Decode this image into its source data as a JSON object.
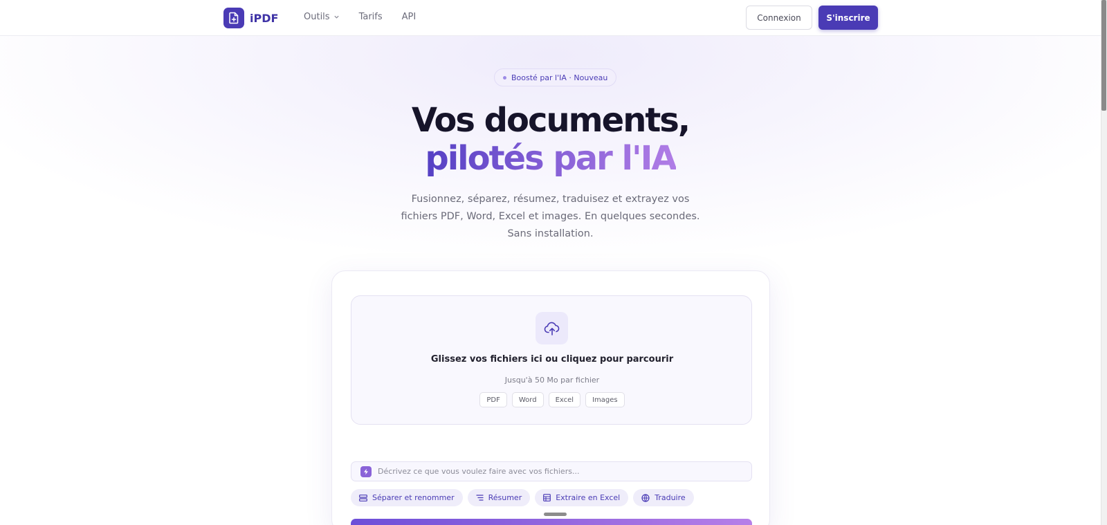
{
  "nav": {
    "logo_text": "iPDF",
    "links": [
      {
        "label": "Outils",
        "has_dropdown": true
      },
      {
        "label": "Tarifs"
      },
      {
        "label": "API"
      }
    ],
    "login_label": "Connexion",
    "signup_label": "S'inscrire"
  },
  "hero": {
    "badge": "Boosté par l'IA · Nouveau",
    "title_line1": "Vos documents,",
    "title_line2": "pilotés par l'IA",
    "subtitle": "Fusionnez, séparez, résumez, traduisez et extrayez vos fichiers PDF, Word, Excel et images. En quelques secondes. Sans installation."
  },
  "upload": {
    "title": "Glissez vos fichiers ici ou cliquez pour parcourir",
    "limit": "Jusqu'à 50 Mo par fichier",
    "formats": [
      "PDF",
      "Word",
      "Excel",
      "Images"
    ],
    "icon": "upload-cloud-icon"
  },
  "prompt": {
    "placeholder": "Décrivez ce que vous voulez faire avec vos fichiers...",
    "icon": "sparkle-icon"
  },
  "actions": [
    {
      "label": "Séparer et renommer",
      "icon": "split-icon"
    },
    {
      "label": "Résumer",
      "icon": "lines-icon"
    },
    {
      "label": "Extraire en Excel",
      "icon": "table-icon"
    },
    {
      "label": "Traduire",
      "icon": "globe-icon"
    }
  ],
  "colors": {
    "brand": "#4a3bb5",
    "accent_gradient_start": "#5540c4",
    "accent_gradient_end": "#b07de6"
  }
}
